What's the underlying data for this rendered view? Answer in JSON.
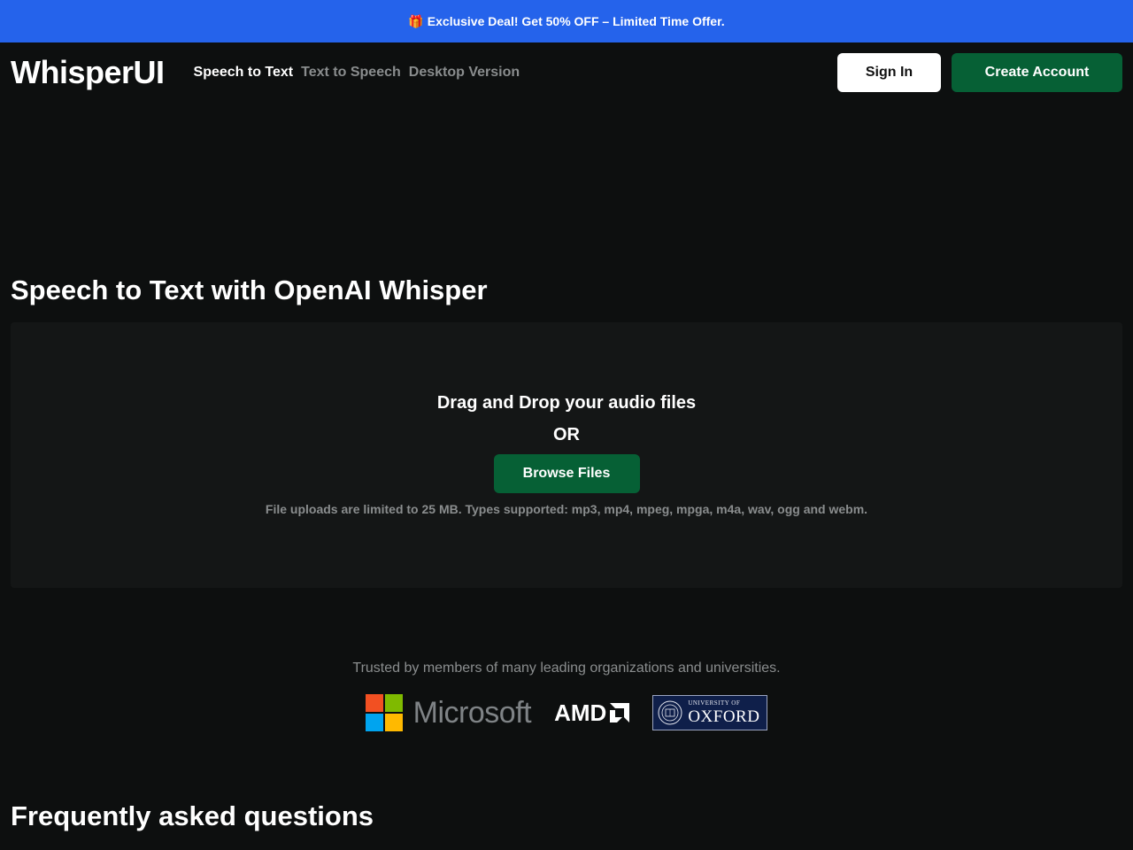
{
  "promo": {
    "icon": "gift-icon",
    "text": "Exclusive Deal! Get 50% OFF – Limited Time Offer.",
    "background": "#2563eb"
  },
  "nav": {
    "logo": "WhisperUI",
    "links": [
      {
        "label": "Speech to Text",
        "active": true
      },
      {
        "label": "Text to Speech",
        "active": false
      },
      {
        "label": "Desktop Version",
        "active": false
      }
    ],
    "sign_in": "Sign In",
    "create_account": "Create Account",
    "accent": "#066035"
  },
  "main": {
    "title": "Speech to Text with OpenAI Whisper",
    "dropzone": {
      "title": "Drag and Drop your audio files",
      "or": "OR",
      "browse": "Browse Files",
      "note": "File uploads are limited to 25 MB. Types supported: mp3, mp4, mpeg, mpga, m4a, wav, ogg and webm."
    }
  },
  "trusted": {
    "text": "Trusted by members of many leading organizations and universities.",
    "logos": {
      "microsoft": "Microsoft",
      "amd": "AMD",
      "oxford_small": "UNIVERSITY OF",
      "oxford_big": "OXFORD"
    }
  },
  "faq": {
    "title": "Frequently asked questions"
  }
}
